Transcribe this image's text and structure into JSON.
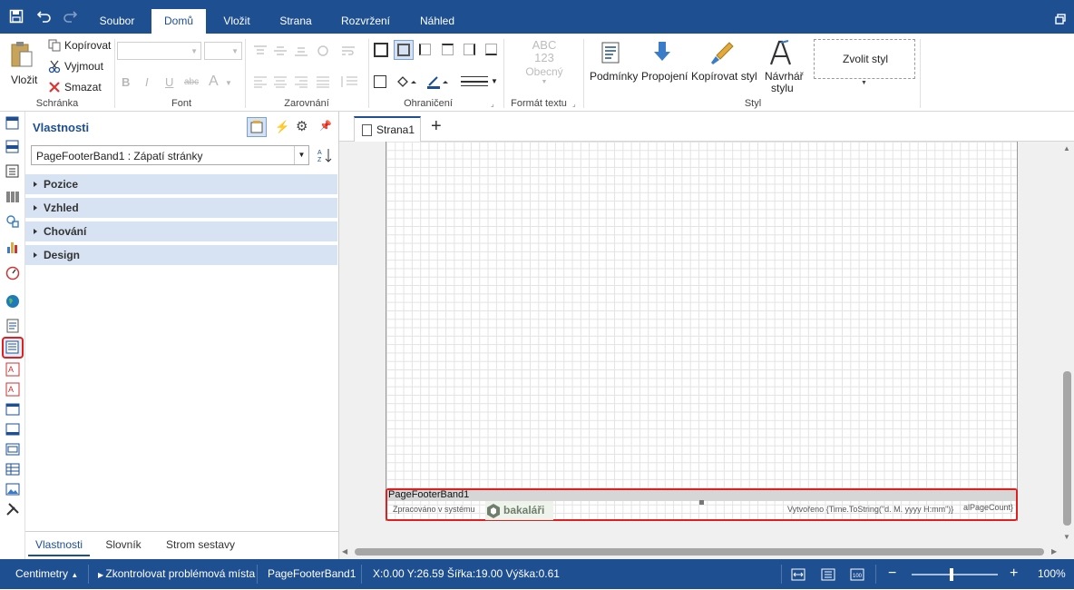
{
  "menu": {
    "tabs": [
      "Soubor",
      "Domů",
      "Vložit",
      "Strana",
      "Rozvržení",
      "Náhled"
    ],
    "active_tab": "Domů"
  },
  "ribbon": {
    "clipboard": {
      "paste": "Vložit",
      "copy": "Kopírovat",
      "cut": "Vyjmout",
      "delete": "Smazat",
      "group": "Schránka"
    },
    "font": {
      "group": "Font"
    },
    "alignment": {
      "group": "Zarovnání"
    },
    "borders": {
      "group": "Ohraničení"
    },
    "text_format": {
      "sample_top": "ABC",
      "sample_bottom": "123",
      "value": "Obecný",
      "group": "Formát textu"
    },
    "style": {
      "conditions": "Podmínky",
      "links": "Propojení",
      "copy_style": "Kopírovat styl",
      "designer_line1": "Návrhář",
      "designer_line2": "stylu",
      "choose_style": "Zvolit styl",
      "group": "Styl"
    }
  },
  "properties": {
    "title": "Vlastnosti",
    "selector_value": "PageFooterBand1 : Zápatí stránky",
    "categories": [
      "Pozice",
      "Vzhled",
      "Chování",
      "Design"
    ],
    "bottom_tabs": [
      "Vlastnosti",
      "Slovník",
      "Strom sestavy"
    ]
  },
  "document": {
    "tab_label": "Strana1",
    "band_name": "PageFooterBand1",
    "left_text": "Zpracováno v systému",
    "logo_text": "bakaláři",
    "created_text": "Vytvořeno {Time.ToString(\"d. M. yyyy H:mm\")}",
    "page_count_text": "alPageCount}"
  },
  "status": {
    "units": "Centimetry",
    "check": "Zkontrolovat problémová místa",
    "component": "PageFooterBand1",
    "coords": "X:0.00 Y:26.59 Šířka:19.00 Výška:0.61",
    "zoom": "100%"
  },
  "colors": {
    "brand": "#1e4f91",
    "category": "#d7e3f2",
    "selection": "#e02020"
  }
}
